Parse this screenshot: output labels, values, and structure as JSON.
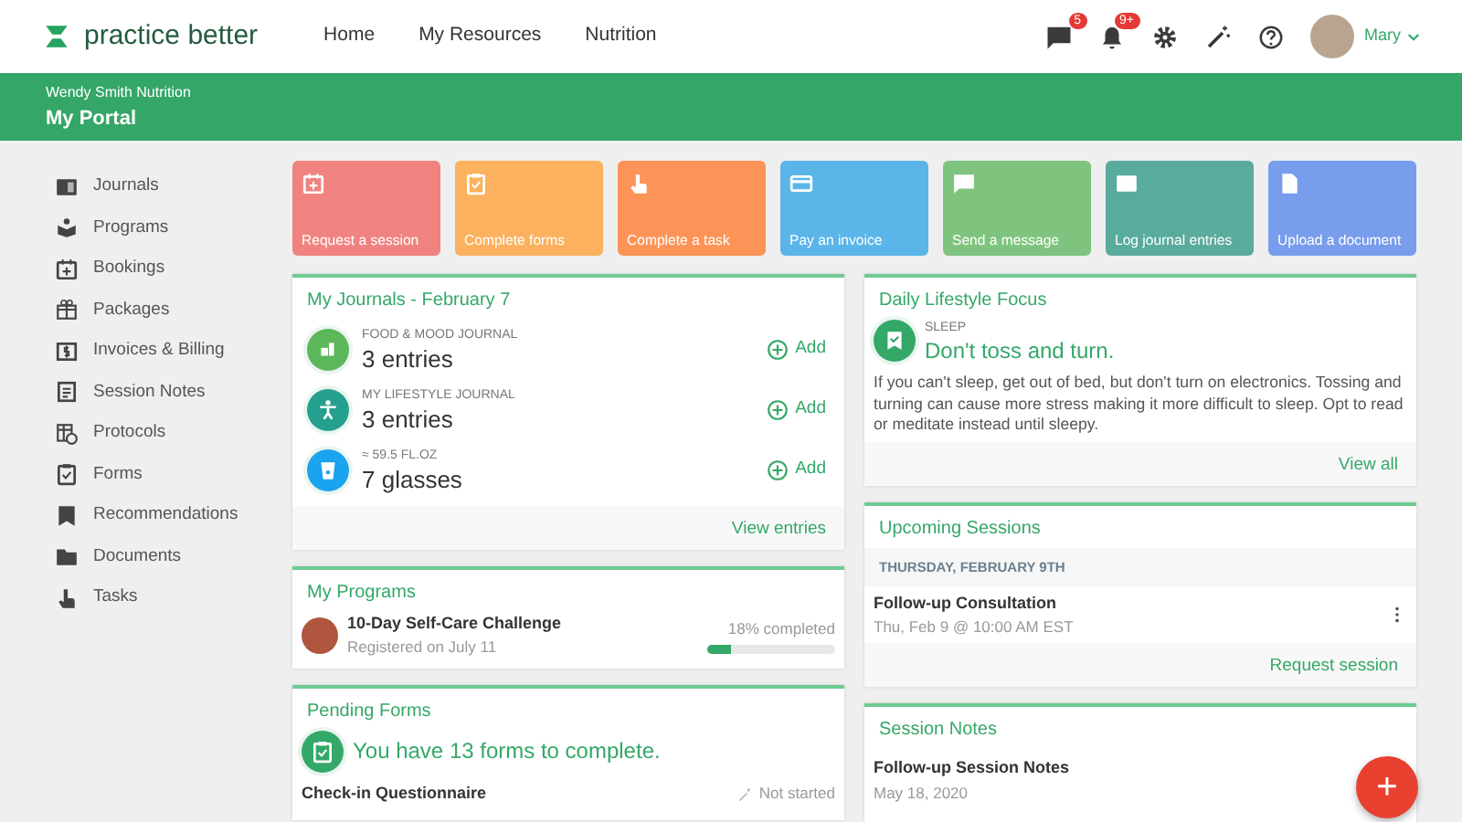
{
  "header": {
    "logo": "practice better",
    "nav": [
      "Home",
      "My Resources",
      "Nutrition"
    ],
    "icons": [
      {
        "kind": "chat",
        "badge": "5"
      },
      {
        "kind": "bell",
        "badge": "9+"
      },
      {
        "kind": "gear"
      },
      {
        "kind": "wand"
      },
      {
        "kind": "help"
      }
    ],
    "user": "Mary"
  },
  "banner": {
    "subtitle": "Wendy Smith Nutrition",
    "title": "My Portal"
  },
  "sidebar": {
    "items": [
      {
        "label": "Journals",
        "kind": "journal"
      },
      {
        "label": "Programs",
        "kind": "program"
      },
      {
        "label": "Bookings",
        "kind": "calendar"
      },
      {
        "label": "Packages",
        "kind": "gift"
      },
      {
        "label": "Invoices & Billing",
        "kind": "dollar"
      },
      {
        "label": "Session Notes",
        "kind": "notes"
      },
      {
        "label": "Protocols",
        "kind": "protocol"
      },
      {
        "label": "Forms",
        "kind": "clipboard"
      },
      {
        "label": "Recommendations",
        "kind": "ribbon"
      },
      {
        "label": "Documents",
        "kind": "folder"
      },
      {
        "label": "Tasks",
        "kind": "hand"
      }
    ]
  },
  "tiles": [
    {
      "label": "Request a session",
      "color": "#f08380",
      "kind": "calendar"
    },
    {
      "label": "Complete forms",
      "color": "#fbb15d",
      "kind": "clipboard"
    },
    {
      "label": "Complete a task",
      "color": "#fd9457",
      "kind": "hand"
    },
    {
      "label": "Pay an invoice",
      "color": "#5bb5e8",
      "kind": "card"
    },
    {
      "label": "Send a message",
      "color": "#7fc47e",
      "kind": "chat"
    },
    {
      "label": "Log journal entries",
      "color": "#59ab9d",
      "kind": "journal"
    },
    {
      "label": "Upload a document",
      "color": "#789ded",
      "kind": "file"
    }
  ],
  "journals": {
    "title": "My Journals - February 7",
    "rows": [
      {
        "label": "FOOD & MOOD JOURNAL",
        "value": "3 entries",
        "color": "#5cb65a",
        "kind": "food",
        "action": "Add"
      },
      {
        "label": "MY LIFESTYLE JOURNAL",
        "value": "3 entries",
        "color": "#26a08e",
        "kind": "person",
        "action": "Add"
      },
      {
        "label": "≈ 59.5 FL.OZ",
        "value": "7 glasses",
        "color": "#1aa3ee",
        "kind": "glass",
        "action": "Add"
      }
    ],
    "link": "View entries"
  },
  "programs": {
    "title": "My Programs",
    "items": [
      {
        "name": "10-Day Self-Care Challenge",
        "registered": "Registered on July 11",
        "progress": "18% completed",
        "level": 0.18
      }
    ]
  },
  "pending_forms": {
    "title": "Pending Forms",
    "message": "You have 13 forms to complete.",
    "forms": [
      {
        "name": "Check-in Questionnaire",
        "status": "Not started"
      }
    ]
  },
  "lifestyle": {
    "title": "Daily Lifestyle Focus",
    "category": "SLEEP",
    "headline": "Don't toss and turn.",
    "body": "If you can't sleep, get out of bed, but don't turn on electronics. Tossing and turning can cause more stress making it more difficult to sleep. Opt to read or meditate instead until sleepy.",
    "link": "View all"
  },
  "upcoming": {
    "title": "Upcoming Sessions",
    "date": "THURSDAY, FEBRUARY 9TH",
    "sessions": [
      {
        "name": "Follow-up Consultation",
        "time": "Thu, Feb 9 @ 10:00 AM EST"
      }
    ],
    "link": "Request session"
  },
  "session_notes": {
    "title": "Session Notes",
    "notes": [
      {
        "name": "Follow-up Session Notes",
        "date": "May 18, 2020"
      }
    ]
  },
  "fab": "+"
}
